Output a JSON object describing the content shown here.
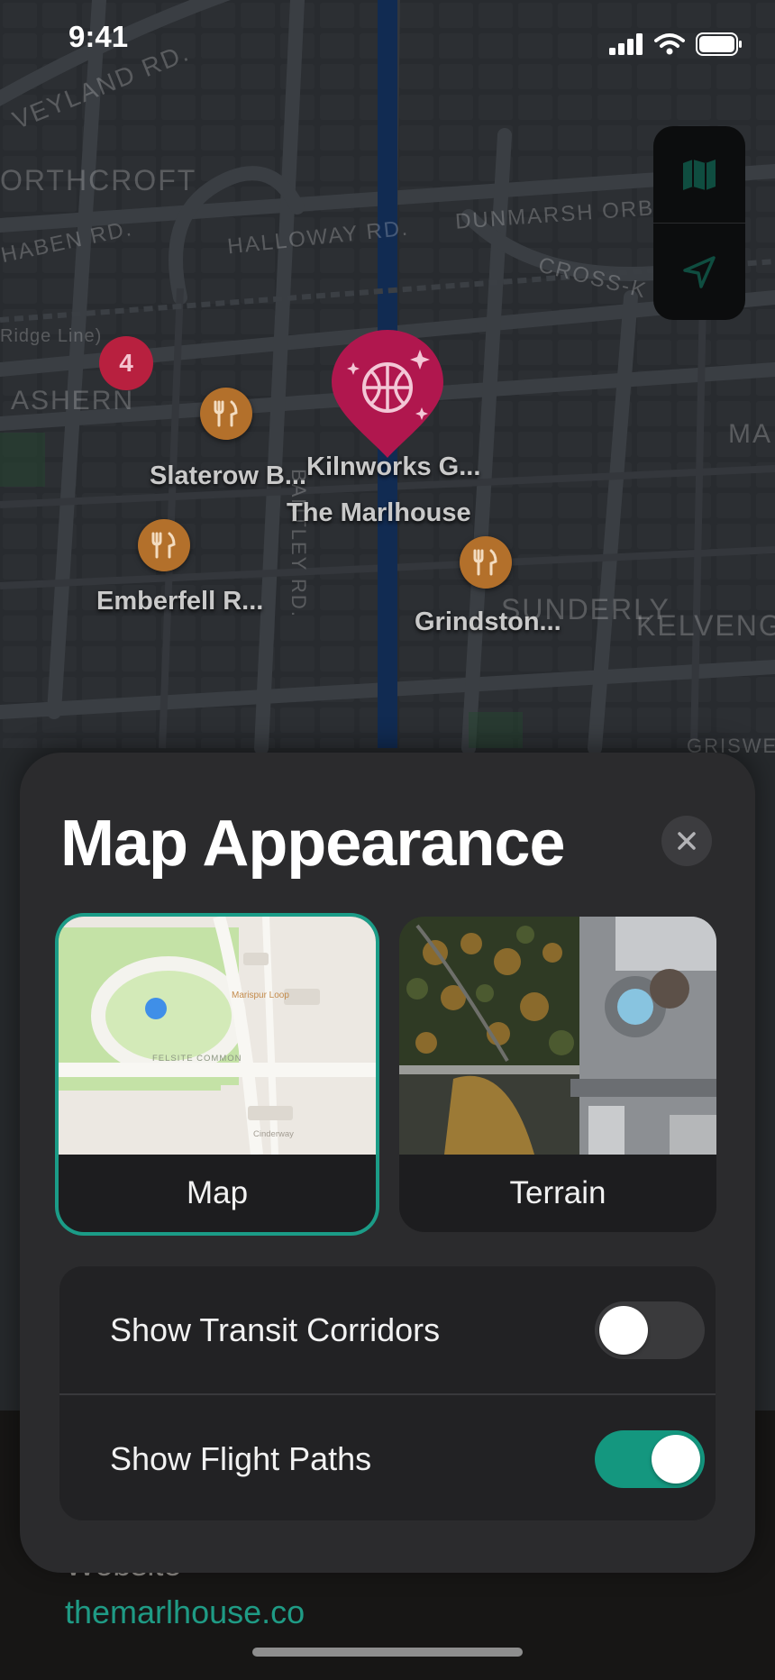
{
  "status_bar": {
    "time": "9:41"
  },
  "map": {
    "street_labels": [
      "VEYLAND RD.",
      "ORTHCROFT",
      "HABEN RD.",
      "HALLOWAY RD.",
      "DUNMARSH ORB",
      "CROSS-K",
      "Ridge Line)",
      "ASHERN",
      "BANTLEY RD.",
      "SUNDERLY",
      "KELVENG",
      "MA",
      "GRISWE"
    ],
    "cluster_count": "4",
    "poi": {
      "slaterow": "Slaterow B...",
      "kilnworks": "Kilnworks G...",
      "marlhouse": "The Marlhouse",
      "emberfell": "Emberfell R...",
      "grindston": "Grindston..."
    },
    "controls": {
      "map_icon": "map-icon",
      "locate_icon": "location-arrow-icon"
    }
  },
  "place": {
    "website_label": "Website",
    "website_url": "themarlhouse.co"
  },
  "sheet": {
    "title": "Map Appearance",
    "close_icon": "close-icon",
    "options": [
      {
        "label": "Map",
        "selected": true,
        "thumb_labels": [
          "Marispur Loop",
          "FELSITE COMMON",
          "Cinderway"
        ]
      },
      {
        "label": "Terrain",
        "selected": false
      }
    ],
    "toggles": [
      {
        "label": "Show Transit Corridors",
        "on": false
      },
      {
        "label": "Show Flight Paths",
        "on": true
      }
    ]
  },
  "colors": {
    "accent": "#14977f",
    "pin_magenta": "#b0174e",
    "pin_restaurant": "#b3702b",
    "sheet_bg": "#2b2b2d"
  }
}
